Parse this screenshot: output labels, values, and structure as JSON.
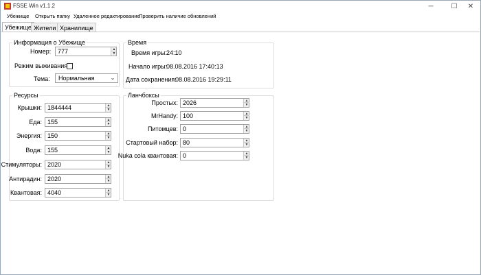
{
  "window": {
    "title": "FSSE Win v1.1.2",
    "controls": {
      "minimize": "─",
      "maximize": "☐",
      "close": "✕"
    }
  },
  "menu": {
    "items": [
      "Убежище",
      "Открыть папку",
      "Удаленное редактирование",
      "Проверить наличие обновлений"
    ]
  },
  "tabs": [
    "Убежище",
    "Жители",
    "Хранилище"
  ],
  "vault_info": {
    "title": "Информация о Убежище",
    "number_label": "Номер:",
    "number_value": "777",
    "survival_label": "Режим выживания:",
    "survival_checked": false,
    "theme_label": "Тема:",
    "theme_value": "Нормальная"
  },
  "time": {
    "title": "Время",
    "game_time_label": "Время игры:",
    "game_time_value": "24:10",
    "start_label": "Начало игры:",
    "start_value": "08.08.2016 17:40:13",
    "save_label": "Дата сохранения:",
    "save_value": "08.08.2016 19:29:11"
  },
  "resources": {
    "title": "Ресурсы",
    "items": [
      {
        "label": "Крышки:",
        "value": "1844444"
      },
      {
        "label": "Еда:",
        "value": "155"
      },
      {
        "label": "Энергия:",
        "value": "150"
      },
      {
        "label": "Вода:",
        "value": "155"
      },
      {
        "label": "Стимуляторы:",
        "value": "2020"
      },
      {
        "label": "Антирадин:",
        "value": "2020"
      },
      {
        "label": "Квантовая:",
        "value": "4040"
      }
    ]
  },
  "lunchboxes": {
    "title": "Ланчбоксы",
    "items": [
      {
        "label": "Простых:",
        "value": "2026"
      },
      {
        "label": "MrHandy:",
        "value": "100"
      },
      {
        "label": "Питомцев:",
        "value": "0"
      },
      {
        "label": "Стартовый набор:",
        "value": "80"
      },
      {
        "label": "Nuka cola квантовая:",
        "value": "0"
      }
    ]
  },
  "colors": {
    "accent": "#0078d7",
    "border": "#dcdcdc"
  },
  "icons": {
    "spinner_up": "▲",
    "spinner_down": "▼",
    "dropdown": "⌄"
  }
}
